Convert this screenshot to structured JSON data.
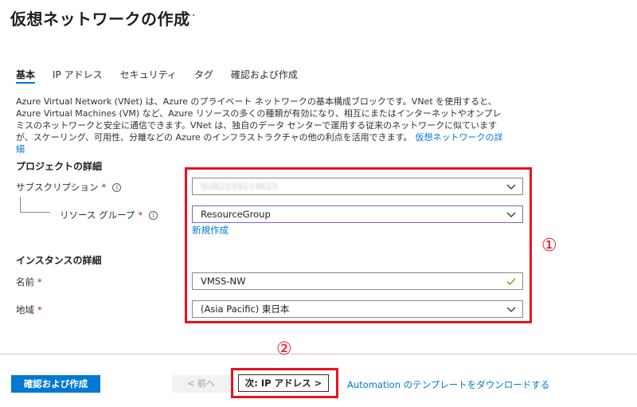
{
  "header": {
    "title": "仮想ネットワークの作成",
    "more_label": "···"
  },
  "tabs": [
    {
      "label": "基本",
      "active": true
    },
    {
      "label": "IP アドレス",
      "active": false
    },
    {
      "label": "セキュリティ",
      "active": false
    },
    {
      "label": "タグ",
      "active": false
    },
    {
      "label": "確認および作成",
      "active": false
    }
  ],
  "description": {
    "text": "Azure Virtual Network (VNet) は、Azure のプライベート ネットワークの基本構成ブロックです。VNet を使用すると、Azure Virtual Machines (VM) など、Azure リソースの多くの種類が有効になり、相互にまたはインターネットやオンプレミスのネットワークと安全に通信できます。VNet は、独自のデータ センターで運用する従来のネットワークに似ていますが、スケーリング、可用性、分離などの Azure のインフラストラクチャの他の利点を活用できます。",
    "link": "仮想ネットワークの詳細"
  },
  "project": {
    "heading": "プロジェクトの詳細",
    "subscription_label": "サブスクリプション",
    "subscription_value": "SUB2103114615",
    "resource_group_label": "リソース グループ",
    "resource_group_value": "ResourceGroup",
    "new_link": "新規作成"
  },
  "instance": {
    "heading": "インスタンスの詳細",
    "name_label": "名前",
    "name_value": "VMSS-NW",
    "region_label": "地域",
    "region_value": "(Asia Pacific) 東日本"
  },
  "required_mark": "*",
  "info_glyph": "i",
  "annotations": {
    "marker1": "①",
    "marker2": "②"
  },
  "footer": {
    "review_create": "確認および作成",
    "prev": "< 前へ",
    "next": "次: IP アドレス >",
    "download": "Automation のテンプレートをダウンロードする"
  },
  "colors": {
    "accent": "#0078d4",
    "highlight": "#e81123",
    "focus_border": "#8764b8",
    "valid_check": "#57a300"
  }
}
